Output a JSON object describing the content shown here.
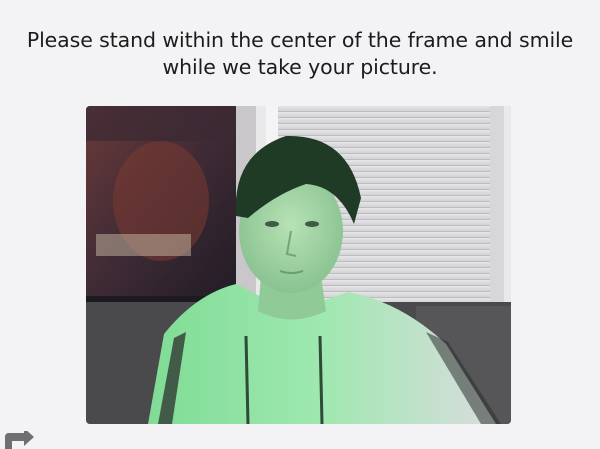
{
  "instructions": {
    "line1": "Please stand within the center of the frame and smile",
    "line2": "while we take your picture."
  },
  "camera": {
    "overlay_color": "#4fd17a"
  },
  "icons": {
    "switch_camera": "switch-camera-icon"
  }
}
